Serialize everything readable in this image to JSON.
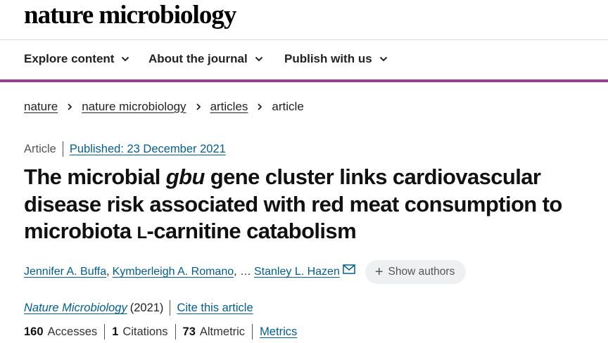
{
  "header": {
    "brand": "nature microbiology"
  },
  "nav": {
    "items": [
      {
        "label": "Explore content"
      },
      {
        "label": "About the journal"
      },
      {
        "label": "Publish with us"
      }
    ]
  },
  "colors": {
    "accent_bar": "#9c3d8f",
    "link": "#025e8d"
  },
  "breadcrumb": {
    "items": [
      "nature",
      "nature microbiology",
      "articles"
    ],
    "current": "article"
  },
  "meta": {
    "type": "Article",
    "published": "Published: 23 December 2021"
  },
  "article": {
    "title_part1": "The microbial ",
    "title_gene": "gbu",
    "title_part2": " gene cluster links cardiovascular disease risk associated with red meat consumption to microbiota ",
    "title_small_caps": "L",
    "title_part3": "-carnitine catabolism"
  },
  "authors": {
    "list": [
      "Jennifer A. Buffa",
      "Kymberleigh A. Romano",
      "Stanley L. Hazen"
    ],
    "sep1": ",",
    "ellipsis": ", …",
    "show_authors": "Show authors",
    "icons": {
      "corresponding": "mail-icon",
      "expand": "plus-icon"
    }
  },
  "citation": {
    "journal": "Nature Microbiology",
    "year": "(2021)",
    "cite": "Cite this article"
  },
  "metrics": {
    "accesses_value": "160",
    "accesses_label": "Accesses",
    "citations_value": "1",
    "citations_label": "Citations",
    "altmetric_value": "73",
    "altmetric_label": "Altmetric",
    "metrics_link": "Metrics"
  }
}
